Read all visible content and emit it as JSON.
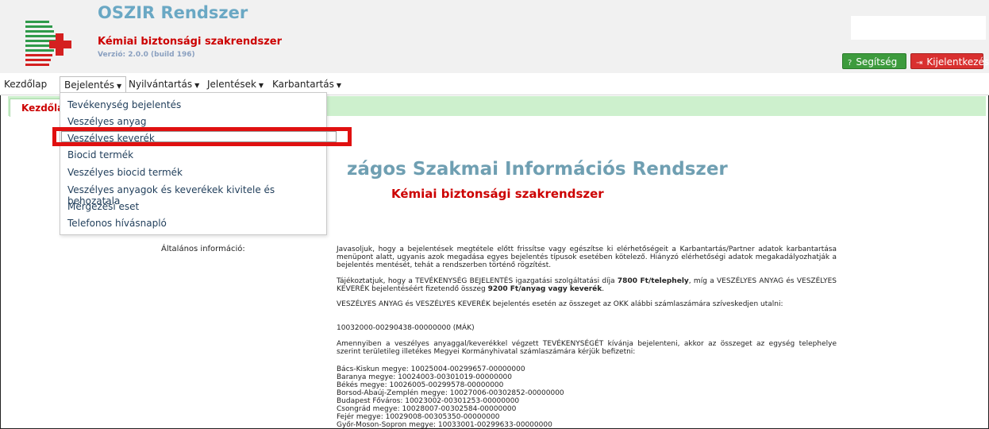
{
  "app": {
    "title": "OSZIR Rendszer",
    "subtitle": "Kémiai biztonsági szakrendszer",
    "version": "Verzió: 2.0.0 (build 196)"
  },
  "buttons": {
    "help": "Segítség",
    "logout": "Kijelentkezés"
  },
  "nav": {
    "home": "Kezdőlap",
    "items": [
      "Bejelentés",
      "Nyilvántartás",
      "Jelentések",
      "Karbantartás"
    ]
  },
  "tab": {
    "label": "Kezdőlap"
  },
  "dropdown": {
    "items": [
      "Tevékenység bejelentés",
      "Veszélyes anyag",
      "Veszélyes keverék",
      "Biocid termék",
      "Veszélyes biocid termék",
      "Veszélyes anyagok és keverékek kivitele és behozatala",
      "Mérgezési eset",
      "Telefonos hívásnapló"
    ],
    "highlighted_index": 2
  },
  "main": {
    "title": "zágos Szakmai Információs Rendszer",
    "subtitle": "Kémiai biztonsági szakrendszer",
    "info_label": "Általános információ:",
    "p1": "Javasoljuk, hogy a bejelentések megtétele előtt frissítse vagy egészítse ki elérhetőségeit a Karbantartás/Partner adatok karbantartása menüpont alatt, ugyanis azok megadása egyes bejelentés típusok esetében kötelező. Hiányzó elérhetőségi adatok megakadályozhatják a bejelentés mentését, tehát a rendszerben történő rögzítést.",
    "p2_a": "Tájékoztatjuk, hogy a TEVÉKENYSÉG BEJELENTÉS igazgatási szolgáltatási díja ",
    "p2_b": "7800 Ft/telephely",
    "p2_c": ", míg a VESZÉLYES ANYAG és VESZÉLYES KEVERÉK bejelentéséért fizetendő összeg ",
    "p2_d": "9200 Ft/anyag vagy keverék",
    "p2_e": ".",
    "p3": "VESZÉLYES ANYAG és VESZÉLYES KEVERÉK bejelentés esetén az összeget az OKK alábbi számlaszámára szíveskedjen utalni:",
    "account": "10032000-00290438-00000000 (MÁK)",
    "p4": "Amennyiben a veszélyes anyaggal/keverékkel végzett TEVÉKENYSÉGÉT kívánja bejelenteni, akkor az összeget az egység telephelye szerint területileg illetékes Megyei Kormányhivatal számlaszámára kérjük befizetni:",
    "counties": [
      "Bács-Kiskun megye: 10025004-00299657-00000000",
      "Baranya megye: 10024003-00301019-00000000",
      "Békés megye: 10026005-00299578-00000000",
      "Borsod-Abaúj-Zemplén megye: 10027006-00302852-00000000",
      "Budapest Főváros: 10023002-00301253-00000000",
      "Csongrád megye: 10028007-00302584-00000000",
      "Fejér megye: 10029008-00305350-00000000",
      "Győr-Moson-Sopron megye: 10033001-00299633-00000000"
    ]
  },
  "colors": {
    "brand_red": "#cc0000",
    "brand_blue": "#6aa8c4",
    "tab_green": "#cdf0cd"
  }
}
